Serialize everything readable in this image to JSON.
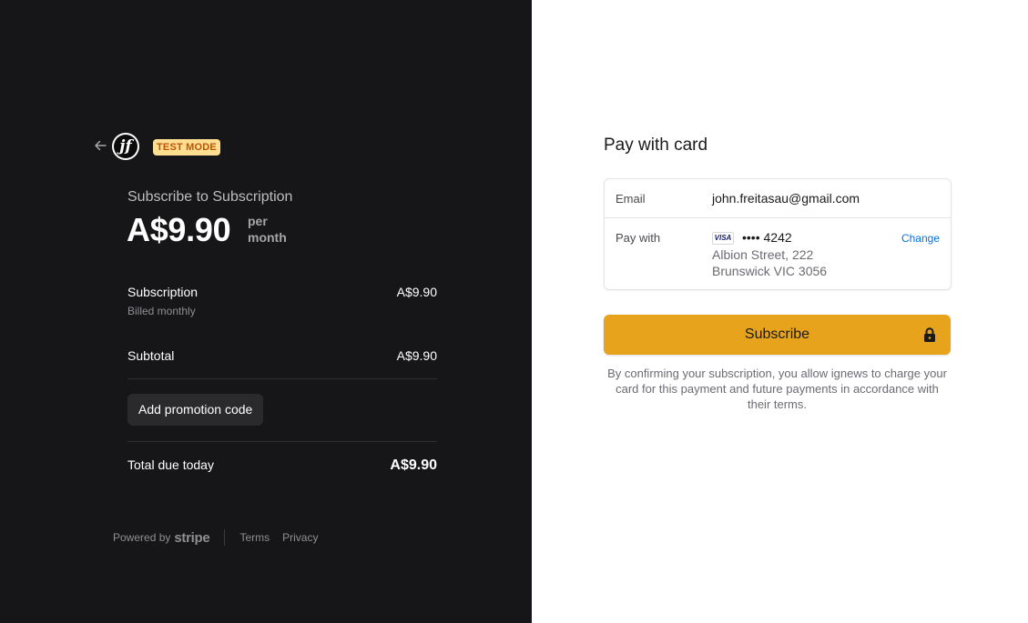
{
  "merchant": {
    "logo_letter": "jf",
    "test_badge": "TEST MODE"
  },
  "summary": {
    "subscribe_to": "Subscribe to Subscription",
    "price": "A$9.90",
    "per_line1": "per",
    "per_line2": "month",
    "line_item": {
      "name": "Subscription",
      "billing": "Billed monthly",
      "amount": "A$9.90"
    },
    "subtotal": {
      "label": "Subtotal",
      "amount": "A$9.90"
    },
    "promo_button": "Add promotion code",
    "total": {
      "label": "Total due today",
      "amount": "A$9.90"
    }
  },
  "footer": {
    "powered_by": "Powered by",
    "brand": "stripe",
    "terms": "Terms",
    "privacy": "Privacy"
  },
  "payment": {
    "title": "Pay with card",
    "email_label": "Email",
    "email_value": "john.freitasau@gmail.com",
    "pay_with_label": "Pay with",
    "card_brand": "VISA",
    "card_number": "•••• 4242",
    "address_line1": "Albion Street, 222",
    "address_line2": "Brunswick VIC 3056",
    "change_link": "Change",
    "subscribe_button": "Subscribe",
    "confirm_text": "By confirming your subscription, you allow ignews to charge your card for this payment and future payments in accordance with their terms."
  },
  "colors": {
    "left_bg": "#161618",
    "accent_button": "#e8a31d",
    "test_badge_bg": "#ffde92",
    "link": "#0570de"
  }
}
